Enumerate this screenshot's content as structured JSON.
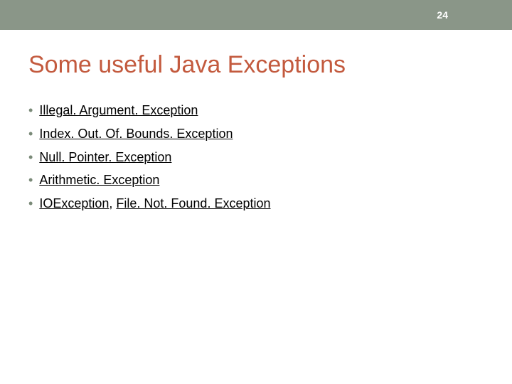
{
  "header": {
    "page_number": "24"
  },
  "title": "Some useful Java Exceptions",
  "bullets": {
    "b0": "Illegal. Argument. Exception",
    "b1": "Index. Out. Of. Bounds. Exception",
    "b2": "Null. Pointer. Exception",
    "b3": "Arithmetic. Exception",
    "b4a": "IOException",
    "b4sep": ", ",
    "b4b": "File. Not. Found. Exception"
  }
}
